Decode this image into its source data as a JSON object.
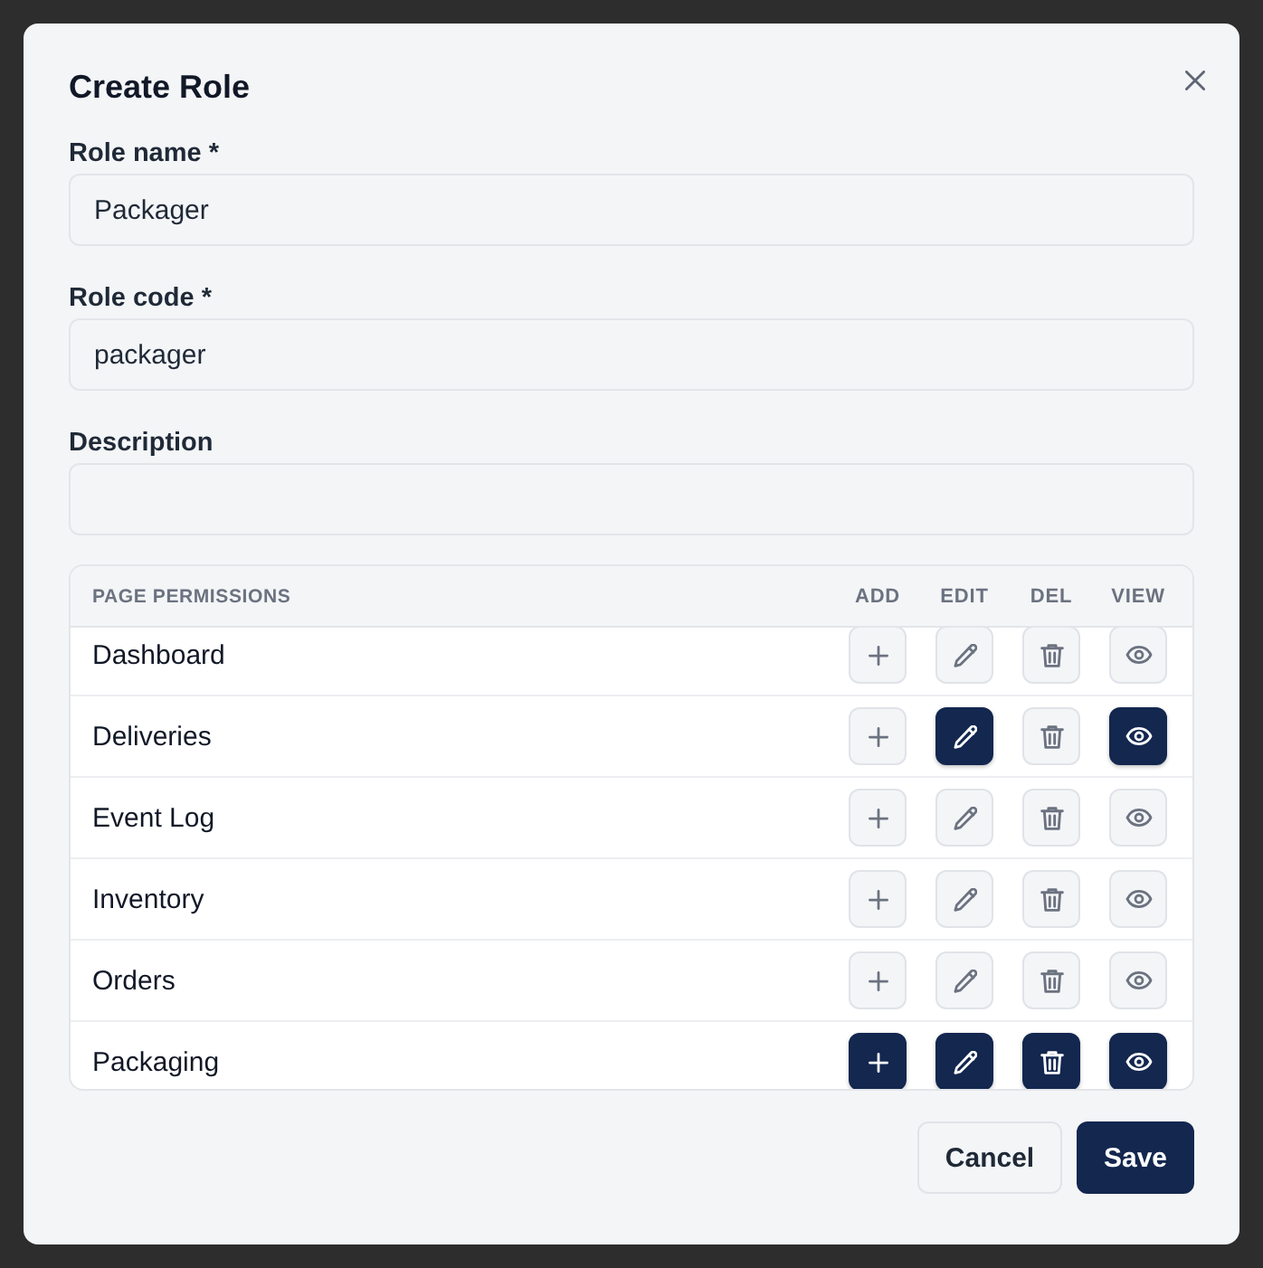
{
  "dialog": {
    "title": "Create Role"
  },
  "fields": [
    {
      "label": "Role name *",
      "value": "Packager"
    },
    {
      "label": "Role code *",
      "value": "packager"
    },
    {
      "label": "Description"
    }
  ],
  "permissions": {
    "heading": "PAGE PERMISSIONS",
    "columns": [
      {
        "label": "ADD",
        "kind": "add"
      },
      {
        "label": "EDIT",
        "kind": "edit"
      },
      {
        "label": "DEL",
        "kind": "del"
      },
      {
        "label": "VIEW",
        "kind": "view"
      }
    ],
    "rows": [
      {
        "page": "Dashboard",
        "add": false,
        "edit": false,
        "del": false,
        "view": false
      },
      {
        "page": "Deliveries",
        "add": false,
        "edit": true,
        "del": false,
        "view": true
      },
      {
        "page": "Event Log",
        "add": false,
        "edit": false,
        "del": false,
        "view": false
      },
      {
        "page": "Inventory",
        "add": false,
        "edit": false,
        "del": false,
        "view": false
      },
      {
        "page": "Orders",
        "add": false,
        "edit": false,
        "del": false,
        "view": false
      },
      {
        "page": "Packaging",
        "add": true,
        "edit": true,
        "del": true,
        "view": true
      }
    ]
  },
  "buttons": [
    {
      "label": "Cancel",
      "kind": "secondary"
    },
    {
      "label": "Save",
      "kind": "primary"
    }
  ]
}
